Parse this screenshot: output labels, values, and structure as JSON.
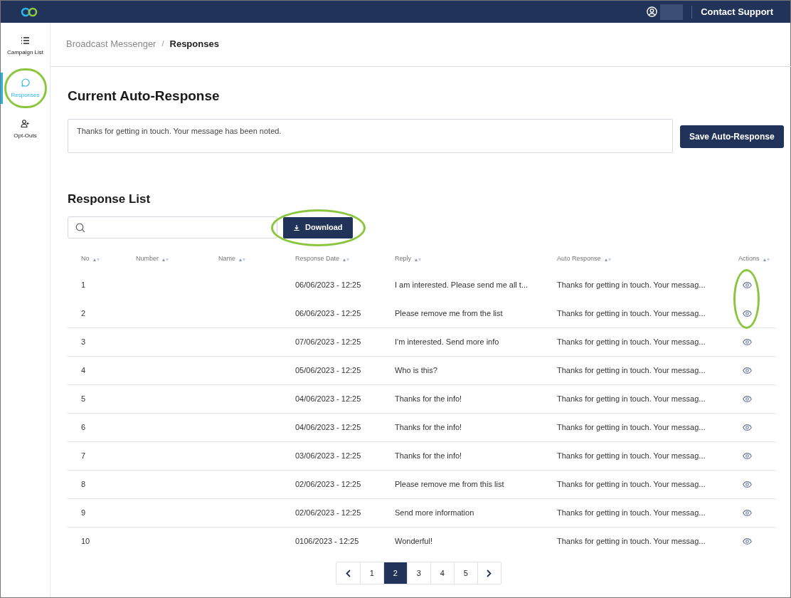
{
  "topbar": {
    "link": "Contact Support"
  },
  "sidebar": {
    "items": [
      {
        "kind": "list",
        "label": "Campaign List",
        "selected": false,
        "highlighted": false
      },
      {
        "kind": "chat",
        "label": "Responses",
        "selected": true,
        "highlighted": true
      },
      {
        "kind": "user",
        "label": "Opt-Outs",
        "selected": false,
        "highlighted": false
      }
    ]
  },
  "breadcrumb": {
    "separator": "/",
    "items": [
      "Broadcast Messenger",
      "Responses"
    ]
  },
  "auto_response": {
    "title": "Current Auto-Response",
    "value": "Thanks for getting in touch. Your message has been noted.",
    "button": "Save Auto-Response"
  },
  "response_list": {
    "title": "Response List",
    "download": {
      "label": "Download",
      "highlighted": true
    }
  },
  "table": {
    "columns": [
      "No",
      "Number",
      "Name",
      "Response Date",
      "Reply",
      "Auto Response",
      "Actions"
    ],
    "rows": [
      {
        "no": "1",
        "date": "06/06/2023 - 12:25",
        "reply": "I am interested. Please send me all t...",
        "auto": "Thanks for getting in touch. Your messag...",
        "highlighted": true
      },
      {
        "no": "2",
        "date": "06/06/2023 - 12:25",
        "reply": "Please remove me from the list",
        "auto": "Thanks for getting in touch. Your messag...",
        "highlighted": true
      },
      {
        "no": "3",
        "date": "07/06/2023 - 12:25",
        "reply": "I'm interested. Send more info",
        "auto": "Thanks for getting in touch. Your messag...",
        "highlighted": false
      },
      {
        "no": "4",
        "date": "05/06/2023 - 12:25",
        "reply": "Who is this?",
        "auto": "Thanks for getting in touch. Your messag...",
        "highlighted": false
      },
      {
        "no": "5",
        "date": "04/06/2023 - 12:25",
        "reply": "Thanks for the info!",
        "auto": "Thanks for getting in touch. Your messag...",
        "highlighted": false
      },
      {
        "no": "6",
        "date": "04/06/2023 - 12:25",
        "reply": "Thanks for the info!",
        "auto": "Thanks for getting in touch. Your messag...",
        "highlighted": false
      },
      {
        "no": "7",
        "date": "03/06/2023 - 12:25",
        "reply": "Thanks for the info!",
        "auto": "Thanks for getting in touch. Your messag...",
        "highlighted": false
      },
      {
        "no": "8",
        "date": "02/06/2023 - 12:25",
        "reply": "Please remove me from this list",
        "auto": "Thanks for getting in touch. Your messag...",
        "highlighted": false
      },
      {
        "no": "9",
        "date": "02/06/2023 - 12:25",
        "reply": "Send more information",
        "auto": "Thanks for getting in touch. Your messag...",
        "highlighted": false
      },
      {
        "no": "10",
        "date": "0106/2023 - 12:25",
        "reply": "Wonderful!",
        "auto": "Thanks for getting in touch. Your messag...",
        "highlighted": false
      }
    ]
  },
  "pagination": {
    "pages": [
      {
        "label": "1",
        "selected": false
      },
      {
        "label": "2",
        "selected": true
      },
      {
        "label": "3",
        "selected": false
      },
      {
        "label": "4",
        "selected": false
      },
      {
        "label": "5",
        "selected": false
      }
    ]
  }
}
